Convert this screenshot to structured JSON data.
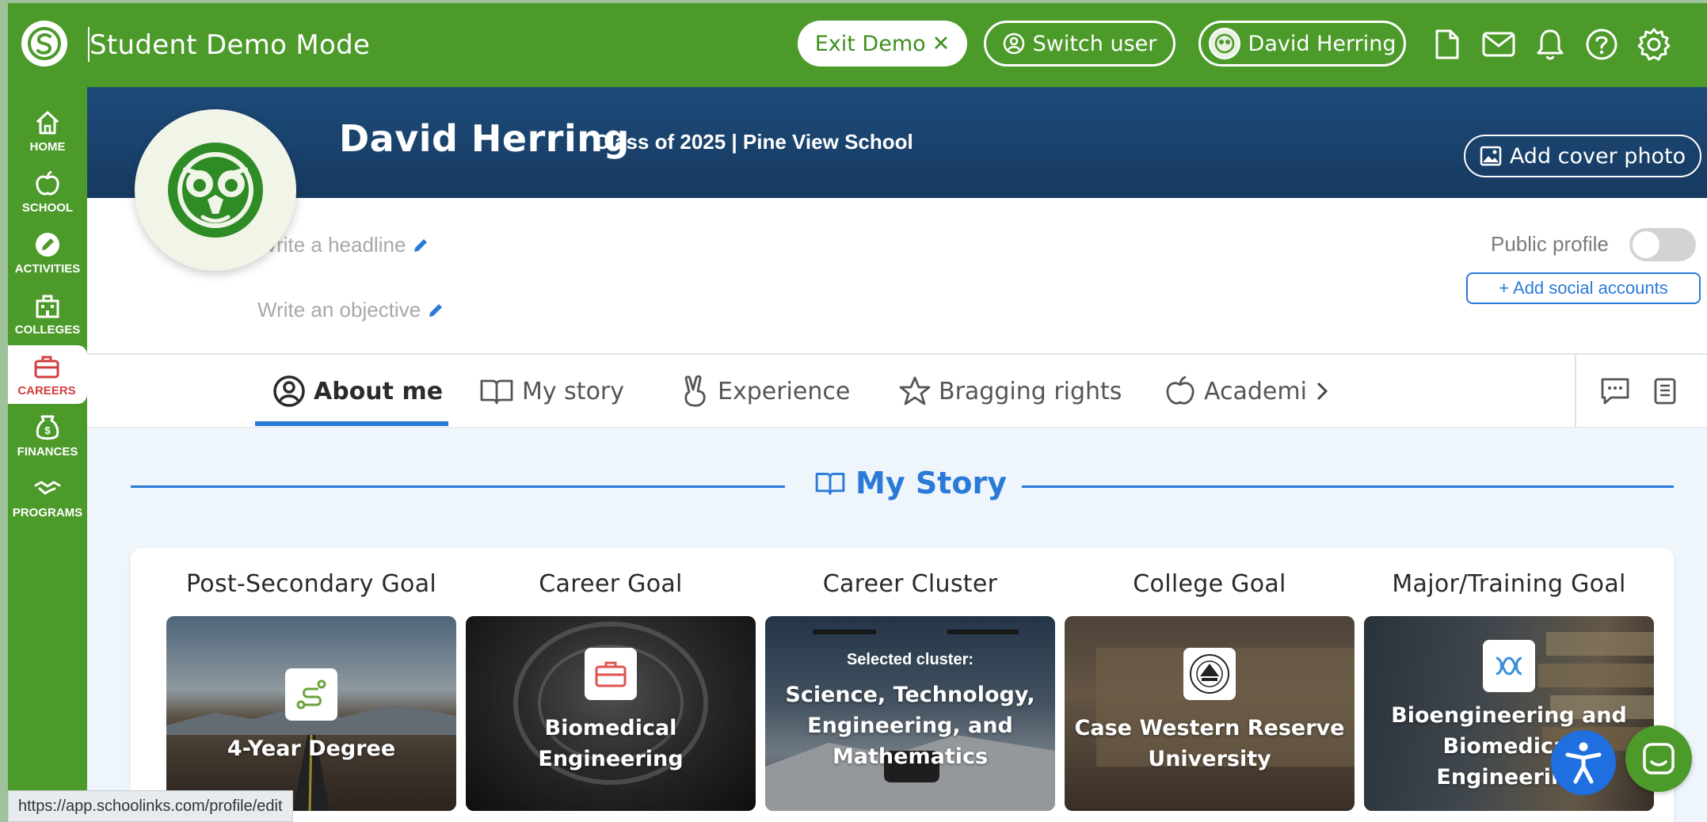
{
  "topbar": {
    "title": "Student Demo Mode",
    "exit_demo": "Exit Demo",
    "switch_user": "Switch user",
    "user_name": "David Herring"
  },
  "sidebar": {
    "items": [
      {
        "label": "HOME",
        "icon": "home-icon"
      },
      {
        "label": "SCHOOL",
        "icon": "apple-icon"
      },
      {
        "label": "ACTIVITIES",
        "icon": "pencil-icon"
      },
      {
        "label": "COLLEGES",
        "icon": "building-icon"
      },
      {
        "label": "CAREERS",
        "icon": "briefcase-icon"
      },
      {
        "label": "FINANCES",
        "icon": "money-bag-icon"
      },
      {
        "label": "PROGRAMS",
        "icon": "handshake-icon"
      }
    ],
    "active": "CAREERS"
  },
  "profile": {
    "name": "David Herring",
    "class_line": "Class of 2025 | Pine View School",
    "add_cover_photo": "Add cover photo",
    "headline_placeholder": "Write a headline",
    "objective_placeholder": "Write an objective",
    "public_profile_label": "Public profile",
    "public_profile_on": false,
    "add_social": "+ Add social accounts"
  },
  "tabs": [
    {
      "label": "About me",
      "icon": "user-circle-icon",
      "active": true
    },
    {
      "label": "My story",
      "icon": "book-icon",
      "active": false
    },
    {
      "label": "Experience",
      "icon": "peace-hand-icon",
      "active": false
    },
    {
      "label": "Bragging rights",
      "icon": "star-icon",
      "active": false
    },
    {
      "label": "Academi",
      "icon": "apple-icon",
      "active": false
    }
  ],
  "section": {
    "title": "My Story"
  },
  "goals": [
    {
      "label": "Post-Secondary Goal",
      "value": "4-Year Degree",
      "icon": "path-icon"
    },
    {
      "label": "Career Goal",
      "value": "Biomedical Engineering",
      "icon": "briefcase-icon"
    },
    {
      "label": "Career Cluster",
      "sub": "Selected cluster:",
      "value": "Science, Technology, Engineering, and Mathematics",
      "icon": ""
    },
    {
      "label": "College Goal",
      "value": "Case Western Reserve University",
      "icon": "college-seal-icon"
    },
    {
      "label": "Major/Training Goal",
      "value": "Bioengineering and Biomedical Engineering",
      "icon": "dna-icon"
    }
  ],
  "status_url": "https://app.schoolinks.com/profile/edit",
  "colors": {
    "brand_green": "#4c9a2a",
    "banner_blue": "#1d4b7a",
    "accent_blue": "#2a7ad8",
    "careers_red": "#d23f3f"
  }
}
